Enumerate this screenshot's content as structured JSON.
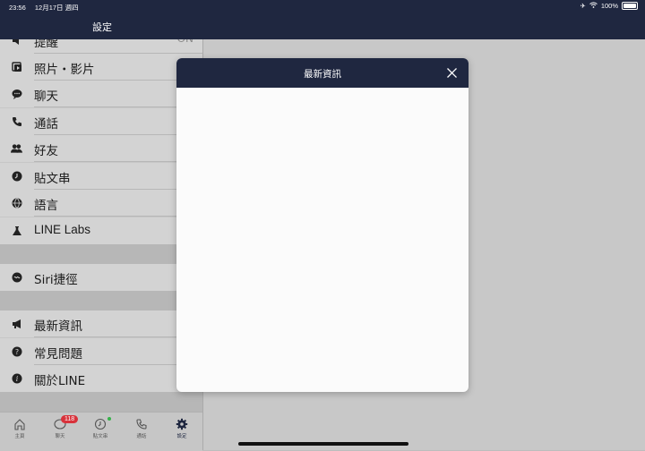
{
  "status_bar": {
    "time": "23:56",
    "date": "12月17日 週四",
    "battery": "100%"
  },
  "nav": {
    "title": "設定"
  },
  "settings": {
    "partial_item": {
      "label": "提醒",
      "value": "ON"
    },
    "items": [
      {
        "label": "照片・影片",
        "icon": "photo-video-icon"
      },
      {
        "label": "聊天",
        "icon": "chat-bubble-icon"
      },
      {
        "label": "通話",
        "icon": "phone-icon"
      },
      {
        "label": "好友",
        "icon": "friends-icon"
      },
      {
        "label": "貼文串",
        "icon": "timeline-icon"
      },
      {
        "label": "語言",
        "icon": "globe-icon"
      },
      {
        "label": "LINE Labs",
        "icon": "flask-icon"
      }
    ],
    "siri": {
      "label": "Siri捷徑",
      "icon": "siri-icon"
    },
    "info_items": [
      {
        "label": "最新資訊",
        "icon": "megaphone-icon"
      },
      {
        "label": "常見問題",
        "icon": "question-icon"
      },
      {
        "label": "關於LINE",
        "icon": "info-icon"
      }
    ]
  },
  "tabbar": {
    "tabs": [
      {
        "label": "主頁",
        "icon": "home-icon"
      },
      {
        "label": "聊天",
        "icon": "chat-icon"
      },
      {
        "label": "貼文串",
        "icon": "clock-icon"
      },
      {
        "label": "通話",
        "icon": "phone-icon"
      },
      {
        "label": "設定",
        "icon": "gear-icon"
      }
    ],
    "chat_badge": "118"
  },
  "modal": {
    "title": "最新資訊"
  },
  "colors": {
    "navy": "#1f2740",
    "badge_red": "#d8323b"
  }
}
